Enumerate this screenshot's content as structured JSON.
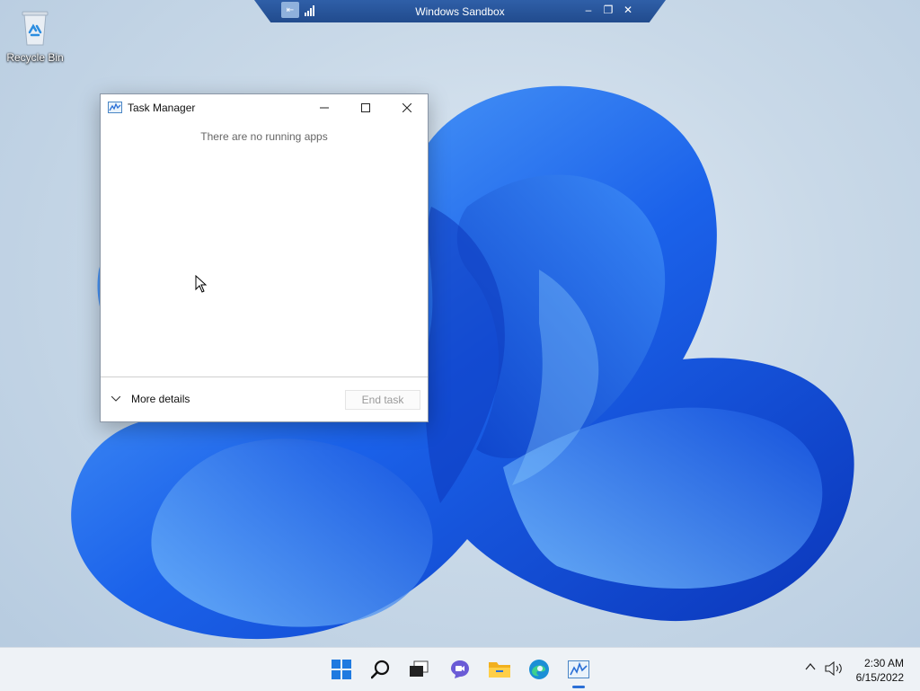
{
  "sandbox_bar": {
    "title": "Windows Sandbox"
  },
  "desktop": {
    "icons": [
      {
        "label": "Recycle Bin"
      }
    ]
  },
  "task_manager": {
    "title": "Task Manager",
    "empty_message": "There are no running apps",
    "more_details_label": "More details",
    "end_task_label": "End task"
  },
  "taskbar": {
    "items": [
      "start-icon",
      "search-icon",
      "task-view-icon",
      "teams-chat-icon",
      "file-explorer-icon",
      "edge-icon",
      "task-manager-icon"
    ],
    "active_item": "task-manager-icon",
    "clock": {
      "time": "2:30 AM",
      "date": "6/15/2022"
    }
  },
  "colors": {
    "accent": "#2a6fd6",
    "sandbox_bar": "#2f5fa8",
    "bloom": "#1a5ee8"
  }
}
